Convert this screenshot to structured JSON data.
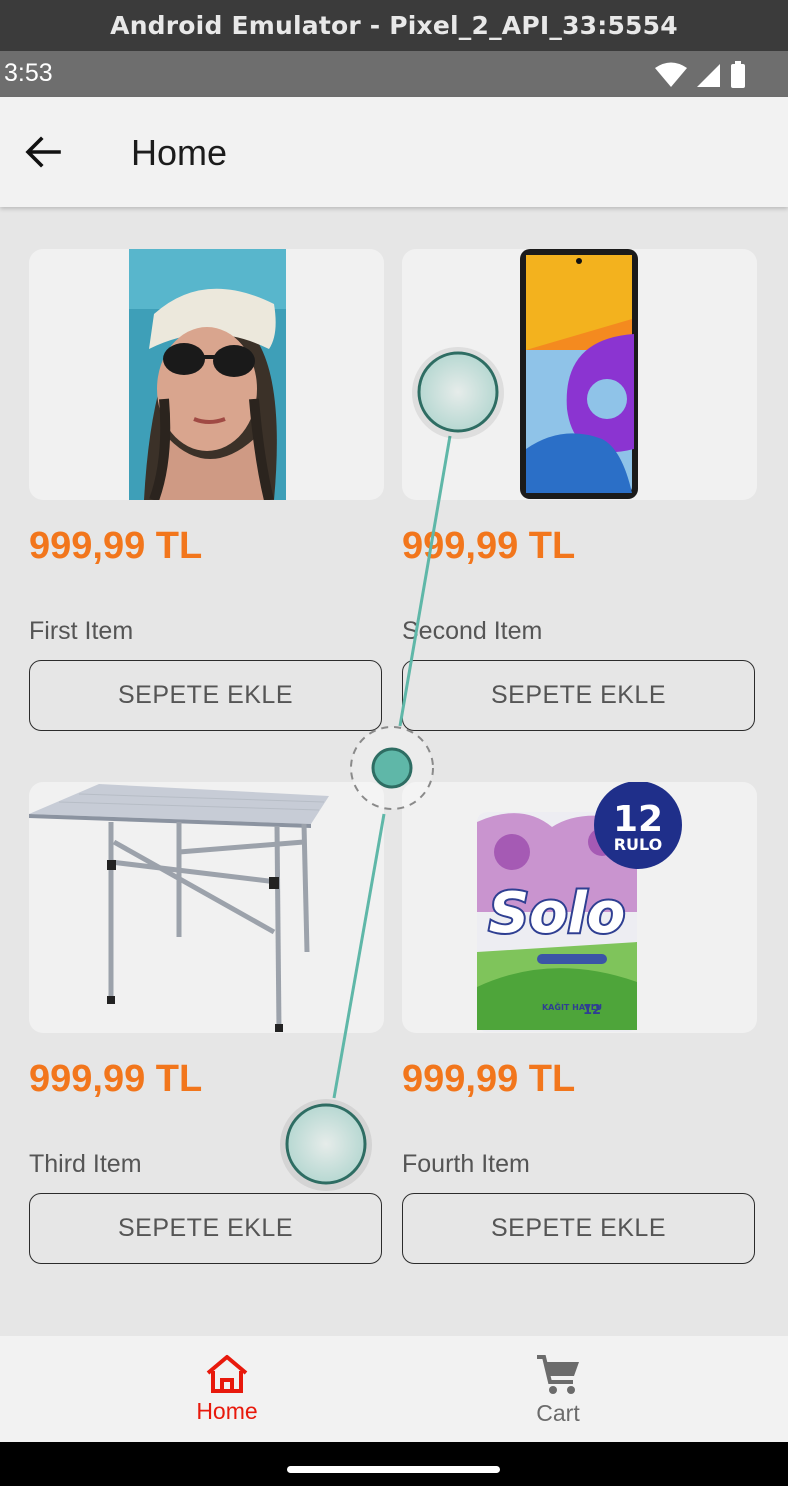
{
  "emulator": {
    "title": "Android Emulator - Pixel_2_API_33:5554"
  },
  "status_bar": {
    "time": "3:53",
    "icons": [
      "wifi-icon",
      "signal-icon",
      "battery-icon"
    ]
  },
  "app_bar": {
    "title": "Home",
    "back_icon": "arrow-left-icon"
  },
  "products": [
    {
      "price": "999,99 TL",
      "name": "First Item",
      "button_label": "SEPETE EKLE",
      "image": "woman-sunglasses-photo"
    },
    {
      "price": "999,99 TL",
      "name": "Second Item",
      "button_label": "SEPETE EKLE",
      "image": "smartphone-photo"
    },
    {
      "price": "999,99 TL",
      "name": "Third Item",
      "button_label": "SEPETE EKLE",
      "image": "folding-table-photo"
    },
    {
      "price": "999,99 TL",
      "name": "Fourth Item",
      "button_label": "SEPETE EKLE",
      "image": "paper-towel-pack-photo",
      "image_text": {
        "badge_number": "12",
        "badge_word": "RULO",
        "brand": "Solo",
        "pack_text": "KAĞIT HAVLU",
        "pack_count": "12"
      }
    }
  ],
  "bottom_nav": [
    {
      "label": "Home",
      "icon": "home-icon",
      "active": true
    },
    {
      "label": "Cart",
      "icon": "cart-icon",
      "active": false
    }
  ],
  "colors": {
    "price": "#f2761c",
    "nav_active": "#e8190c",
    "nav_inactive": "#6b6b6b",
    "gesture": "#5fb7a8"
  }
}
